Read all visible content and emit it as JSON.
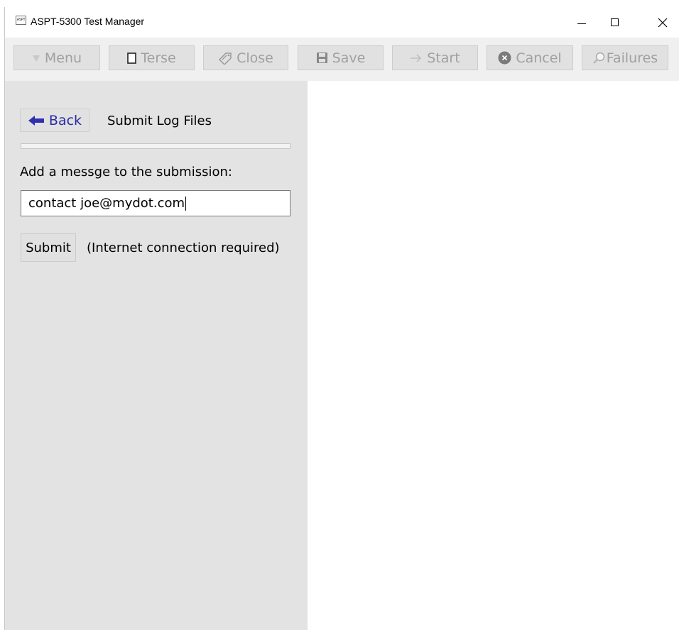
{
  "window": {
    "icon_text": "ASPT",
    "title": "ASPT-5300 Test Manager"
  },
  "toolbar": {
    "buttons": [
      {
        "label": "Menu",
        "icon": "triangle-down-icon",
        "enabled": false
      },
      {
        "label": "Terse",
        "icon": "square-icon",
        "enabled": false
      },
      {
        "label": "Close",
        "icon": "tag-icon",
        "enabled": false
      },
      {
        "label": "Save",
        "icon": "floppy-disk-icon",
        "enabled": false
      },
      {
        "label": "Start",
        "icon": "arrow-right-icon",
        "enabled": false
      },
      {
        "label": "Cancel",
        "icon": "x-circle-icon",
        "enabled": false
      },
      {
        "label": "Failures",
        "icon": "magnifier-icon",
        "enabled": false
      }
    ]
  },
  "panel": {
    "back_label": "Back",
    "title": "Submit Log Files",
    "progress": 0,
    "message_label": "Add a messge to the submission:",
    "message_value": "contact joe@mydot.com",
    "submit_label": "Submit",
    "submit_note": "(Internet connection required)"
  },
  "colors": {
    "panel_bg": "#e3e3e3",
    "toolbar_bg": "#f0f0f0",
    "back_text": "#2a2aa8",
    "disabled_text": "#a0a0a0"
  }
}
